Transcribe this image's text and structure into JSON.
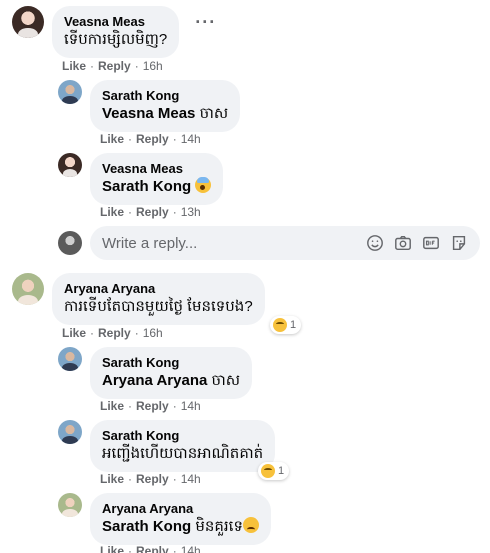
{
  "comments": [
    {
      "author": "Veasna Meas",
      "text": "ទើបការម្សិលមិញ?",
      "actions": {
        "like": "Like",
        "reply": "Reply",
        "time": "16h"
      },
      "more_label": "···"
    },
    {
      "author": "Sarath Kong",
      "tag": "Veasna Meas",
      "text": "ចាស",
      "actions": {
        "like": "Like",
        "reply": "Reply",
        "time": "14h"
      }
    },
    {
      "author": "Veasna Meas",
      "tag": "Sarath Kong",
      "text": "",
      "emoji": "face-screaming-icon",
      "actions": {
        "like": "Like",
        "reply": "Reply",
        "time": "13h"
      }
    },
    {
      "author": "Aryana Aryana",
      "text": "ការទើបតែបានមួយថ្ងៃ មែនទេបង?",
      "actions": {
        "like": "Like",
        "reply": "Reply",
        "time": "16h"
      },
      "reaction": {
        "icon": "haha-reaction-icon",
        "count": "1"
      }
    },
    {
      "author": "Sarath Kong",
      "tag": "Aryana Aryana",
      "text": "ចាស",
      "actions": {
        "like": "Like",
        "reply": "Reply",
        "time": "14h"
      }
    },
    {
      "author": "Sarath Kong",
      "text": "អញ្ជើងហើយបានអាណិតគាត់",
      "actions": {
        "like": "Like",
        "reply": "Reply",
        "time": "14h"
      },
      "reaction": {
        "icon": "sad-reaction-icon",
        "count": "1"
      }
    },
    {
      "author": "Aryana Aryana",
      "tag": "Sarath Kong",
      "text": "មិនគួរទេ",
      "emoji": "sad-face-icon",
      "actions": {
        "like": "Like",
        "reply": "Reply",
        "time": "14h"
      }
    }
  ],
  "reply_box": {
    "placeholder": "Write a reply...",
    "icons": [
      "emoji-icon",
      "camera-icon",
      "gif-icon",
      "sticker-icon"
    ]
  }
}
